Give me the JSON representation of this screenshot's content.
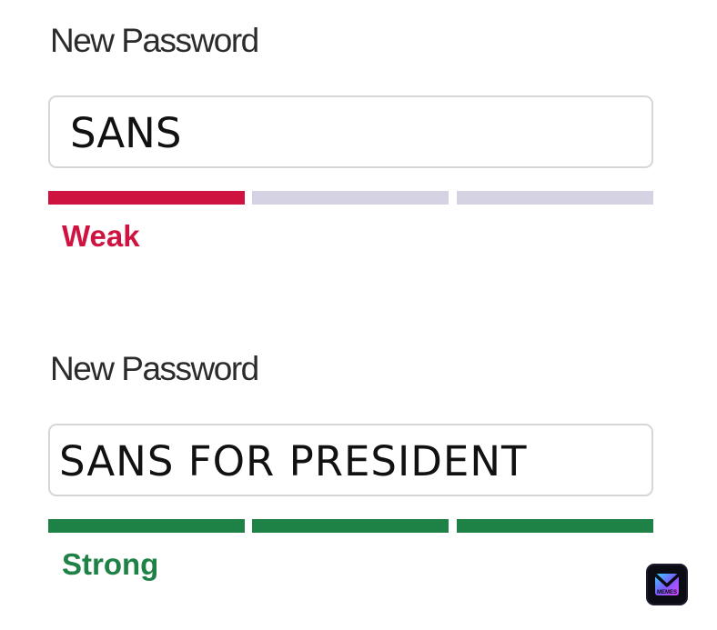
{
  "colors": {
    "weak": "#cf1341",
    "strong": "#1e8145",
    "inactive_segment": "#d5d3e3",
    "field_border": "#d6d6d6",
    "label_text": "#2b2b2b"
  },
  "weak_field": {
    "label": "New Password",
    "value": "SANS",
    "strength": "Weak",
    "segments_filled": 1,
    "segments_total": 3
  },
  "strong_field": {
    "label": "New Password",
    "value": "SANS FOR PRESIDENT",
    "strength": "Strong",
    "segments_filled": 3,
    "segments_total": 3
  },
  "watermark": {
    "icon": "memes-logo-icon",
    "text": "MEMES"
  }
}
